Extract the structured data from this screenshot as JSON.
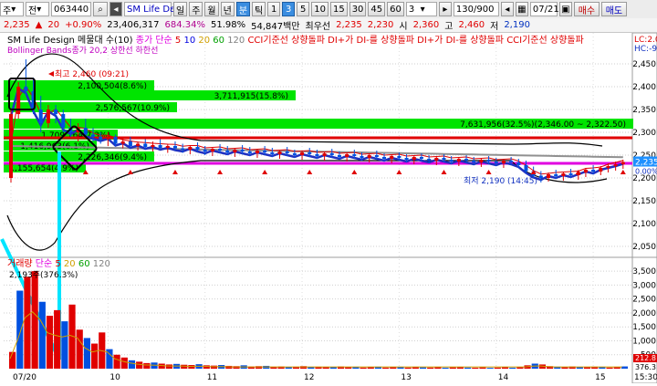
{
  "toolbar": {
    "market_select": "주",
    "board_select": "전",
    "code": "063440",
    "search_icon": "search-icon",
    "stock_name": "SM Life Dε",
    "period_day": "일",
    "period_week": "주",
    "period_month": "월",
    "period_year": "년",
    "period_min": "분",
    "period_tick": "틱",
    "interval_1": "1",
    "interval_3": "3",
    "interval_5": "5",
    "interval_10": "10",
    "interval_15": "15",
    "interval_30": "30",
    "interval_45": "45",
    "interval_60": "60",
    "interval_custom": "3",
    "count": "130/900",
    "date": "07/21",
    "buy_label": "매수",
    "sell_label": "매도"
  },
  "quote": {
    "price": "2,235",
    "change": "20",
    "change_pct": "+0.90%",
    "volume": "23,406,317",
    "vol_ratio": "684.34%",
    "foreign": "51.98%",
    "trade_value": "54,847백만",
    "low_label": "최우선",
    "bid": "2,235",
    "ask": "2,230",
    "open_label": "시",
    "open": "2,360",
    "high_label": "고",
    "high": "2,460",
    "low2_label": "저",
    "low": "2,190"
  },
  "price_panel": {
    "line1_title": "SM Life Design 메물대 수(10)",
    "line1_items": [
      {
        "text": "종가 단순",
        "color": "#e000e0"
      },
      {
        "text": "5",
        "color": "#e00000"
      },
      {
        "text": "10",
        "color": "#0000e0"
      },
      {
        "text": "20",
        "color": "#d0a000"
      },
      {
        "text": "60",
        "color": "#00a000"
      },
      {
        "text": "120",
        "color": "#808080"
      },
      {
        "text": "CCI기준선 상향돌파",
        "color": "#e00000"
      },
      {
        "text": "DI+가 DI-를 상향돌파",
        "color": "#e00000"
      },
      {
        "text": "DI+가 DI-를 상향돌파",
        "color": "#e00000"
      },
      {
        "text": "CCI기준선 상향돌파",
        "color": "#e00000"
      }
    ],
    "line2": "Bollinger Bands종가 20,2  상한선  하한선",
    "right_labels": [
      "LC:2.0",
      "HC:-9"
    ],
    "volume_profile": [
      {
        "label": "2,100,504(8.6%)"
      },
      {
        "label": "3,711,915(15.8%)"
      },
      {
        "label": "2,576,567(10.9%)"
      },
      {
        "label": "7,631,956(32.5%)(2,346.00 ~ 2,322.50)"
      },
      {
        "label": "1,709,764(7.3%)"
      },
      {
        "label": "1,416,963(6.1%)"
      },
      {
        "label": "2,226,346(9.4%)"
      },
      {
        "label": "1,155,654(4.9%)"
      }
    ],
    "high_marker": "최고 2,460 (09:21)",
    "low_marker": "최저 2,190 (14:45)",
    "price_tag": "2,235",
    "price_tag2": "0.00%",
    "line_colors": {
      "red_line": "#e00000",
      "magenta_line": "#e000e0",
      "cyan_marks": "#00e5ff"
    }
  },
  "volume_panel": {
    "title_items": [
      {
        "text": "거래량",
        "color": "#e00000"
      },
      {
        "text": "단순",
        "color": "#e000e0"
      },
      {
        "text": "5",
        "color": "#e00000"
      },
      {
        "text": "20",
        "color": "#d0a000"
      },
      {
        "text": "60",
        "color": "#00a000"
      },
      {
        "text": "120",
        "color": "#808080"
      }
    ],
    "value_text": "2,193주(376.3%)",
    "right_tags": [
      "212.8",
      "376.3"
    ]
  },
  "chart_data": [
    {
      "type": "candlestick",
      "title": "SM Life Design",
      "interval": "3분",
      "y_ticks": [
        2050,
        2100,
        2150,
        2200,
        2250,
        2300,
        2350,
        2400,
        2450
      ],
      "ylim": [
        2030,
        2490
      ],
      "x_ticks": [
        "07/20",
        "10",
        "11",
        "12",
        "13",
        "14",
        "15"
      ],
      "x_tail": "15:30",
      "high": 2460,
      "low": 2190,
      "last": 2235,
      "ohlc": [
        [
          2200,
          2350,
          2190,
          2340
        ],
        [
          2340,
          2410,
          2330,
          2400
        ],
        [
          2400,
          2460,
          2380,
          2390
        ],
        [
          2390,
          2420,
          2340,
          2350
        ],
        [
          2350,
          2380,
          2300,
          2320
        ],
        [
          2320,
          2360,
          2310,
          2350
        ],
        [
          2350,
          2360,
          2320,
          2340
        ],
        [
          2340,
          2350,
          2300,
          2310
        ],
        [
          2310,
          2330,
          2290,
          2300
        ],
        [
          2300,
          2320,
          2280,
          2310
        ],
        [
          2310,
          2330,
          2290,
          2295
        ],
        [
          2295,
          2310,
          2280,
          2290
        ],
        [
          2290,
          2300,
          2275,
          2285
        ],
        [
          2285,
          2300,
          2270,
          2290
        ],
        [
          2290,
          2295,
          2270,
          2275
        ],
        [
          2275,
          2290,
          2265,
          2280
        ],
        [
          2280,
          2290,
          2265,
          2270
        ],
        [
          2270,
          2280,
          2260,
          2275
        ],
        [
          2275,
          2285,
          2262,
          2268
        ],
        [
          2268,
          2280,
          2258,
          2272
        ],
        [
          2272,
          2285,
          2262,
          2266
        ],
        [
          2266,
          2275,
          2255,
          2270
        ],
        [
          2270,
          2280,
          2260,
          2265
        ],
        [
          2265,
          2275,
          2255,
          2262
        ],
        [
          2262,
          2272,
          2252,
          2268
        ],
        [
          2268,
          2278,
          2258,
          2262
        ],
        [
          2262,
          2270,
          2250,
          2258
        ],
        [
          2258,
          2268,
          2248,
          2264
        ],
        [
          2264,
          2274,
          2254,
          2260
        ],
        [
          2260,
          2270,
          2250,
          2256
        ],
        [
          2256,
          2266,
          2246,
          2262
        ],
        [
          2262,
          2272,
          2252,
          2258
        ],
        [
          2258,
          2268,
          2248,
          2254
        ],
        [
          2254,
          2264,
          2244,
          2260
        ],
        [
          2260,
          2270,
          2250,
          2256
        ],
        [
          2256,
          2266,
          2246,
          2252
        ],
        [
          2252,
          2262,
          2242,
          2258
        ],
        [
          2258,
          2268,
          2248,
          2254
        ],
        [
          2254,
          2262,
          2244,
          2250
        ],
        [
          2250,
          2260,
          2240,
          2256
        ],
        [
          2256,
          2266,
          2246,
          2252
        ],
        [
          2252,
          2262,
          2242,
          2248
        ],
        [
          2248,
          2258,
          2238,
          2254
        ],
        [
          2254,
          2264,
          2244,
          2250
        ],
        [
          2250,
          2258,
          2240,
          2246
        ],
        [
          2246,
          2256,
          2236,
          2252
        ],
        [
          2252,
          2262,
          2242,
          2248
        ],
        [
          2248,
          2256,
          2238,
          2244
        ],
        [
          2244,
          2254,
          2234,
          2250
        ],
        [
          2250,
          2260,
          2240,
          2246
        ],
        [
          2246,
          2254,
          2236,
          2242
        ],
        [
          2242,
          2252,
          2232,
          2248
        ],
        [
          2248,
          2256,
          2238,
          2244
        ],
        [
          2244,
          2252,
          2234,
          2240
        ],
        [
          2240,
          2250,
          2230,
          2246
        ],
        [
          2246,
          2254,
          2236,
          2242
        ],
        [
          2242,
          2250,
          2232,
          2238
        ],
        [
          2238,
          2248,
          2228,
          2244
        ],
        [
          2244,
          2252,
          2234,
          2240
        ],
        [
          2240,
          2248,
          2230,
          2236
        ],
        [
          2236,
          2246,
          2226,
          2242
        ],
        [
          2242,
          2250,
          2232,
          2238
        ],
        [
          2238,
          2246,
          2228,
          2234
        ],
        [
          2234,
          2244,
          2224,
          2240
        ],
        [
          2240,
          2248,
          2230,
          2236
        ],
        [
          2236,
          2244,
          2226,
          2232
        ],
        [
          2232,
          2242,
          2222,
          2238
        ],
        [
          2238,
          2246,
          2228,
          2234
        ],
        [
          2234,
          2242,
          2222,
          2228
        ],
        [
          2228,
          2238,
          2210,
          2215
        ],
        [
          2215,
          2225,
          2200,
          2205
        ],
        [
          2205,
          2215,
          2190,
          2200
        ],
        [
          2200,
          2212,
          2192,
          2208
        ],
        [
          2208,
          2218,
          2198,
          2204
        ],
        [
          2204,
          2214,
          2194,
          2210
        ],
        [
          2210,
          2220,
          2200,
          2206
        ],
        [
          2206,
          2216,
          2196,
          2212
        ],
        [
          2212,
          2222,
          2202,
          2218
        ],
        [
          2218,
          2228,
          2208,
          2214
        ],
        [
          2214,
          2226,
          2206,
          2222
        ],
        [
          2222,
          2232,
          2212,
          2226
        ],
        [
          2226,
          2236,
          2216,
          2230
        ],
        [
          2230,
          2240,
          2220,
          2235
        ]
      ]
    },
    {
      "type": "bar",
      "title": "거래량",
      "y_ticks": [
        500,
        1000,
        1500,
        2000,
        2500,
        3000,
        3500
      ],
      "ylim": [
        0,
        3800
      ],
      "values": [
        600,
        2800,
        3300,
        3500,
        2400,
        1900,
        2100,
        1700,
        2300,
        1400,
        1100,
        900,
        1300,
        700,
        500,
        400,
        300,
        250,
        200,
        220,
        180,
        150,
        170,
        140,
        130,
        160,
        120,
        110,
        130,
        100,
        90,
        120,
        80,
        90,
        100,
        70,
        80,
        60,
        70,
        90,
        60,
        70,
        50,
        60,
        80,
        50,
        60,
        40,
        50,
        70,
        40,
        50,
        60,
        40,
        50,
        45,
        40,
        55,
        35,
        45,
        50,
        40,
        35,
        45,
        30,
        40,
        50,
        35,
        60,
        120,
        180,
        150,
        90,
        70,
        60,
        80,
        50,
        60,
        70,
        50,
        40,
        60,
        80
      ]
    }
  ]
}
